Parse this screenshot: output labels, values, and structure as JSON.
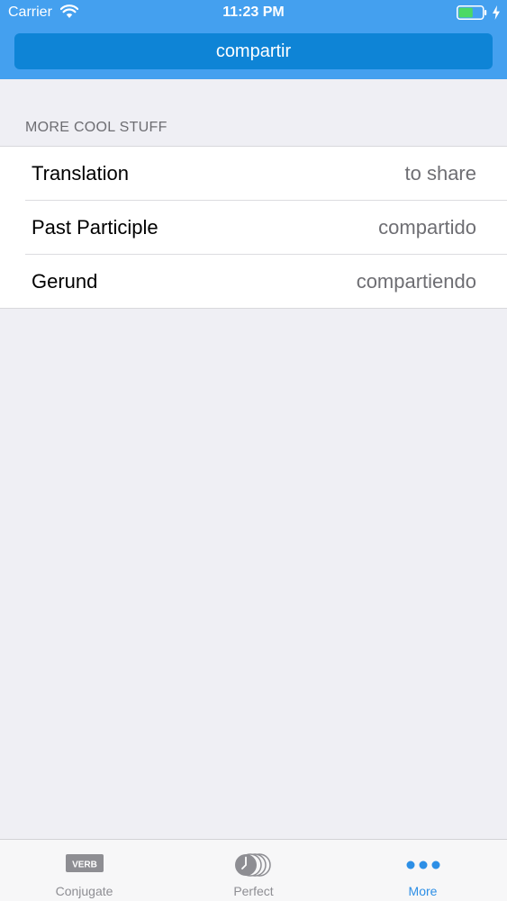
{
  "status_bar": {
    "carrier": "Carrier",
    "time": "11:23 PM",
    "wifi_icon": "wifi-icon",
    "battery_icon": "battery-icon",
    "battery_level": 0.6,
    "charging_icon": "bolt-icon"
  },
  "header": {
    "verb": "compartir"
  },
  "section": {
    "title": "MORE COOL STUFF",
    "rows": [
      {
        "label": "Translation",
        "value": "to share"
      },
      {
        "label": "Past Participle",
        "value": "compartido"
      },
      {
        "label": "Gerund",
        "value": "compartiendo"
      }
    ]
  },
  "tab_bar": {
    "tabs": [
      {
        "label": "Conjugate",
        "icon": "verb-icon",
        "icon_text": "VERB",
        "active": false
      },
      {
        "label": "Perfect",
        "icon": "clock-stack-icon",
        "active": false
      },
      {
        "label": "More",
        "icon": "more-dots-icon",
        "active": true
      }
    ]
  },
  "colors": {
    "header_bg": "#44a0ef",
    "button_bg": "#0e84d6",
    "active_tab": "#2d8fe6",
    "inactive_tab": "#8e8e93",
    "page_bg": "#efeff4"
  }
}
